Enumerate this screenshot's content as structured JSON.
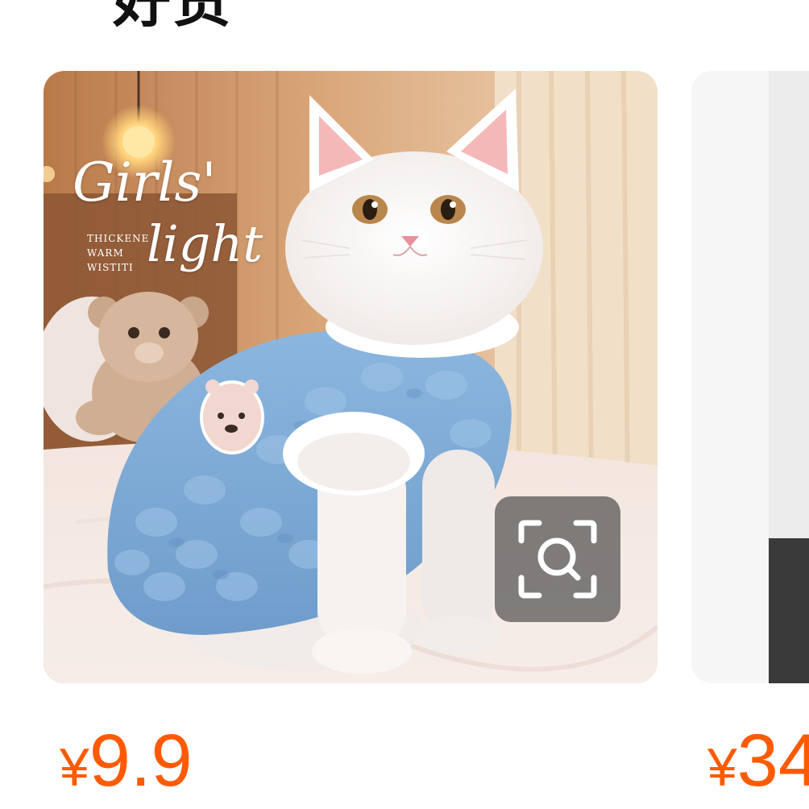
{
  "header": {
    "title": "好货"
  },
  "products": [
    {
      "image_overlay": {
        "headline_1": "Girls'",
        "headline_2": "light",
        "small_lines": [
          "THICKENE",
          "WARM",
          "WISTITI"
        ]
      },
      "image_search_icon": "camera-scan-search-icon",
      "price": {
        "currency": "¥",
        "amount": "9.9"
      }
    },
    {
      "price": {
        "currency": "¥",
        "amount": "34"
      }
    }
  ],
  "colors": {
    "price": "#ff5a00",
    "search_button_bg": "#505050"
  }
}
